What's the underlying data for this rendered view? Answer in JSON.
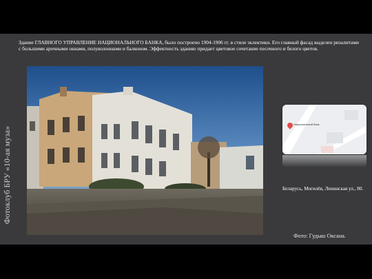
{
  "side_title": "Фотоклуб БРУ «10-ая муза»",
  "description": "Здание ГЛАВНОГО УПРАВЛЕНИЕ НАЦИОНАЛЬНОГО БАНКА, было построено 1904-1906 гг. в стиле эклектики. Его главный фасад выделен ризалитами с большими арочными окнами, полуколоннами и балконом. Эффектность зданию придает цветовое сочетание песочного и белого цветов.",
  "map": {
    "place_label": "Национальный банк"
  },
  "address": "Беларусь, Могилёв, Ленинская ул., 80.",
  "credit": "Фото: Гудько Оксана.",
  "colors": {
    "slide_bg": "#3a3a3c",
    "letterbox": "#000000",
    "facade_sand": "#c9a77a",
    "facade_white": "#e8e6e0",
    "sky_blue": "#2b5f9b",
    "map_pin": "#e24b4b"
  }
}
